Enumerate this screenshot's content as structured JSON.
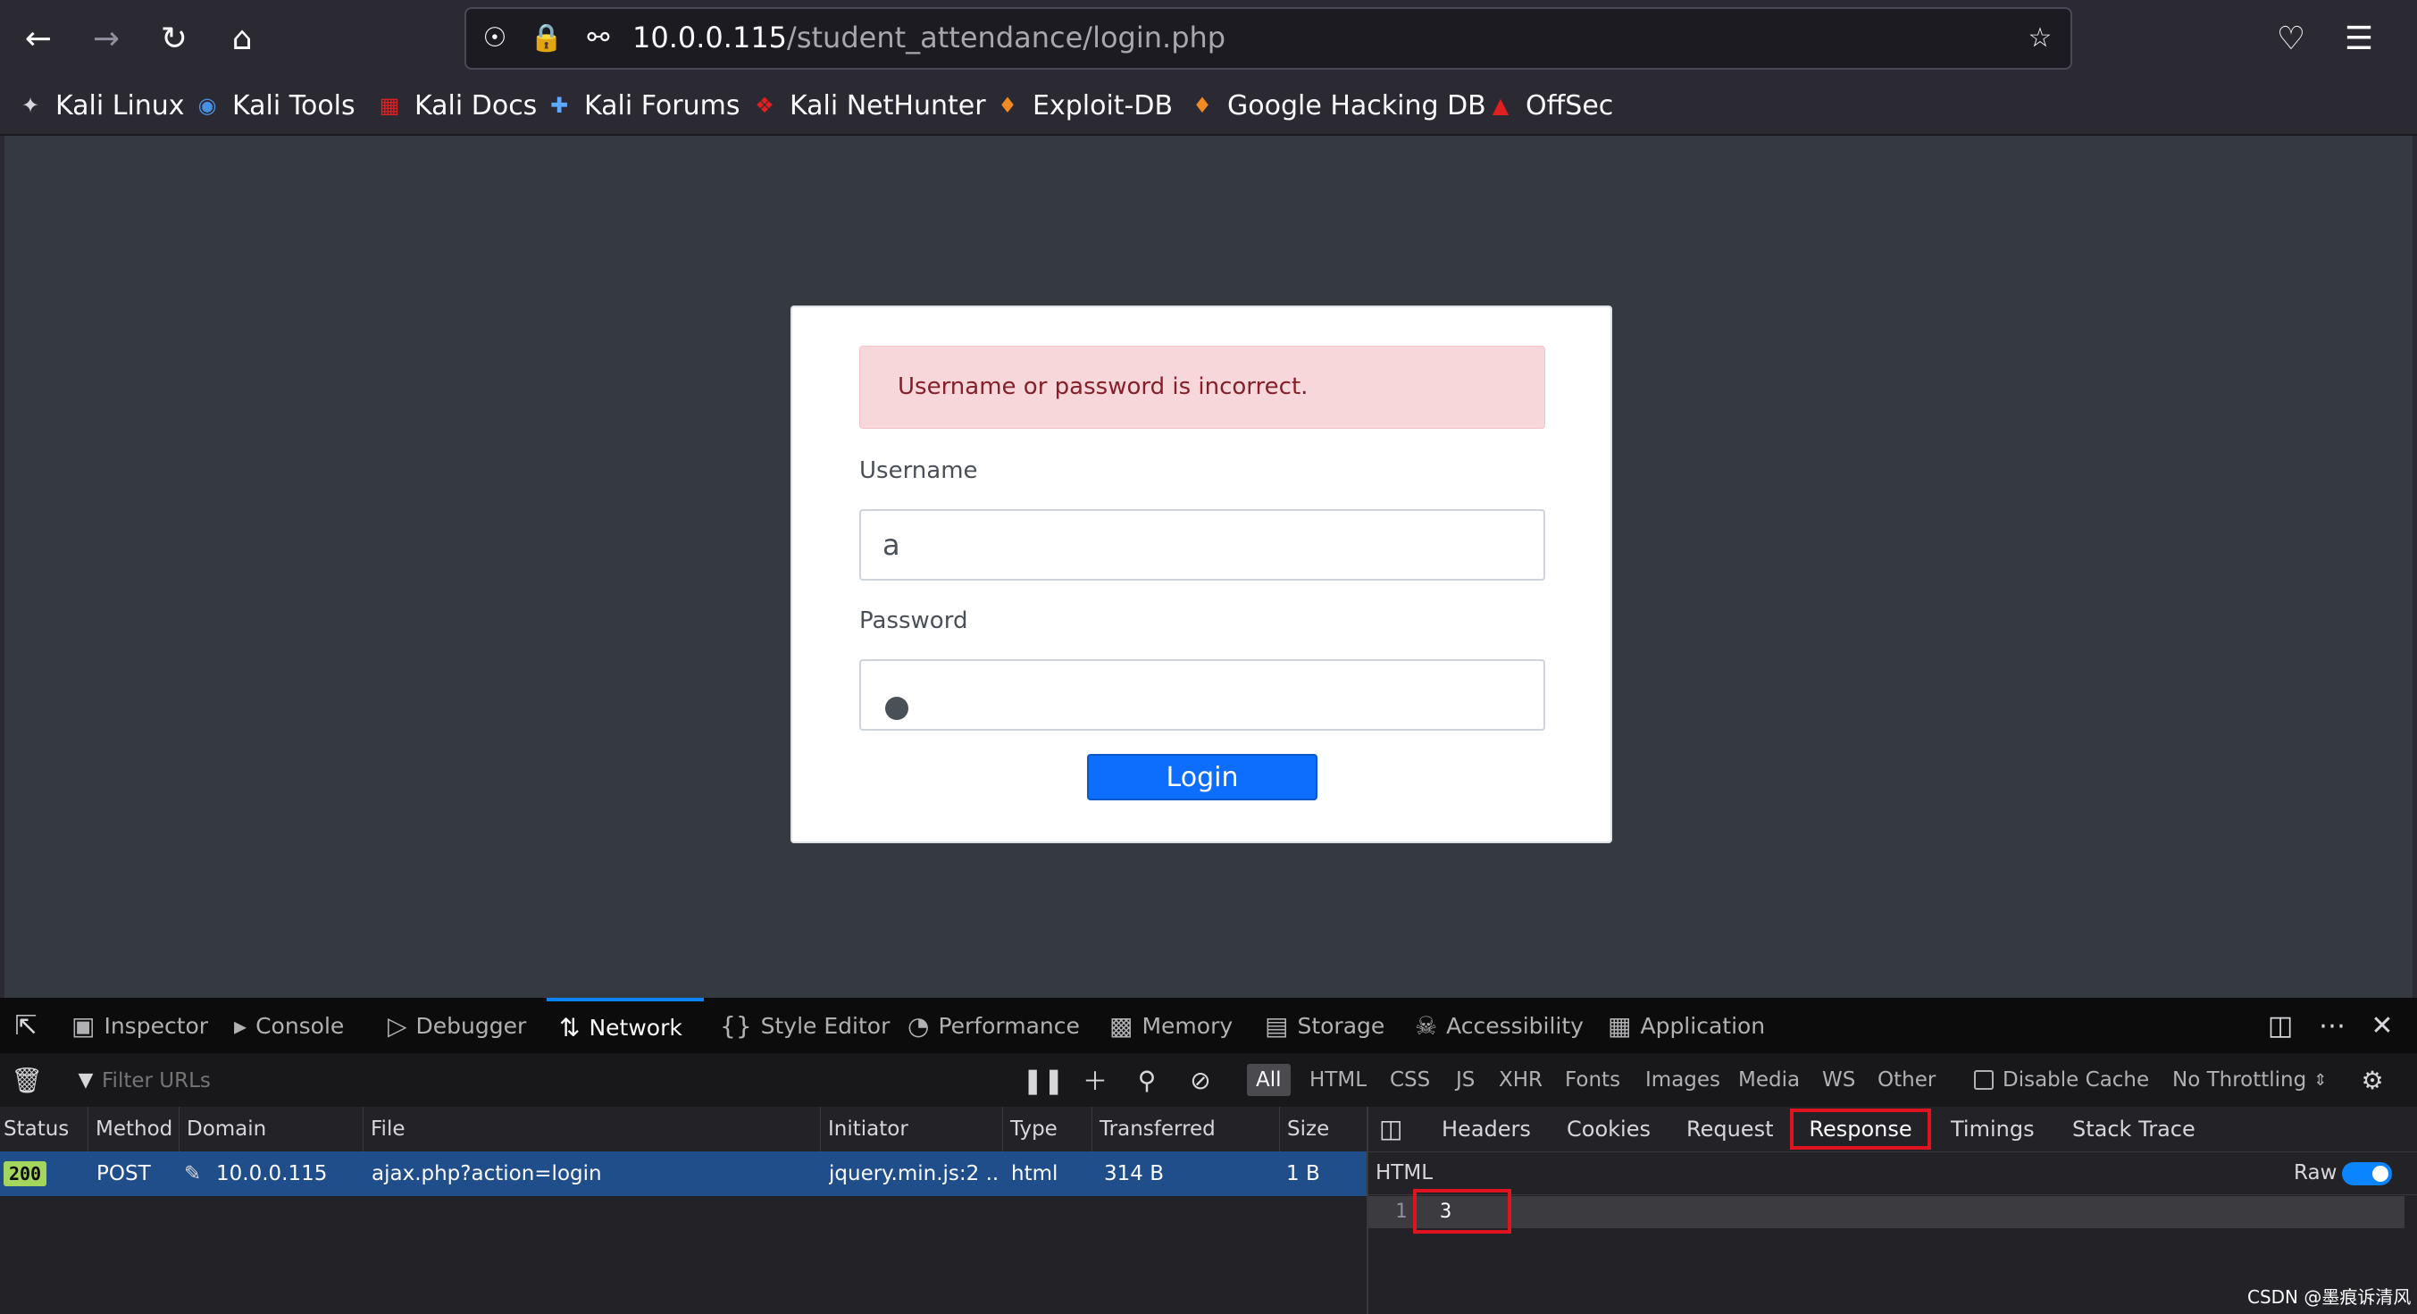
{
  "browser": {
    "url_host": "10.0.0.115",
    "url_path": "/student_attendance/login.php"
  },
  "bookmarks": [
    {
      "label": "Kali Linux",
      "icon": "kali-dragon-icon"
    },
    {
      "label": "Kali Tools",
      "icon": "kali-tools-icon"
    },
    {
      "label": "Kali Docs",
      "icon": "kali-docs-icon"
    },
    {
      "label": "Kali Forums",
      "icon": "kali-forums-icon"
    },
    {
      "label": "Kali NetHunter",
      "icon": "nethunter-icon"
    },
    {
      "label": "Exploit-DB",
      "icon": "exploit-db-icon"
    },
    {
      "label": "Google Hacking DB",
      "icon": "ghdb-icon"
    },
    {
      "label": "OffSec",
      "icon": "offsec-icon"
    }
  ],
  "login": {
    "alert": "Username or password is incorrect.",
    "username_label": "Username",
    "username_value": "a",
    "password_label": "Password",
    "button": "Login"
  },
  "devtools": {
    "tabs": [
      "Inspector",
      "Console",
      "Debugger",
      "Network",
      "Style Editor",
      "Performance",
      "Memory",
      "Storage",
      "Accessibility",
      "Application"
    ],
    "selected_tab": "Network",
    "filter_placeholder": "Filter URLs",
    "types": [
      "All",
      "HTML",
      "CSS",
      "JS",
      "XHR",
      "Fonts",
      "Images",
      "Media",
      "WS",
      "Other"
    ],
    "disable_cache": "Disable Cache",
    "throttling": "No Throttling",
    "columns": [
      "Status",
      "Method",
      "Domain",
      "File",
      "Initiator",
      "Type",
      "Transferred",
      "Size"
    ],
    "row": {
      "status": "200",
      "method": "POST",
      "domain": "10.0.0.115",
      "file": "ajax.php?action=login",
      "initiator": "jquery.min.js:2 ...",
      "type": "html",
      "transferred": "314 B",
      "size": "1 B"
    },
    "side_tabs": [
      "Headers",
      "Cookies",
      "Request",
      "Response",
      "Timings",
      "Stack Trace"
    ],
    "response_type": "HTML",
    "raw_label": "Raw",
    "line_number": "1",
    "response_value": "3"
  },
  "watermark": "CSDN @墨痕诉清风"
}
